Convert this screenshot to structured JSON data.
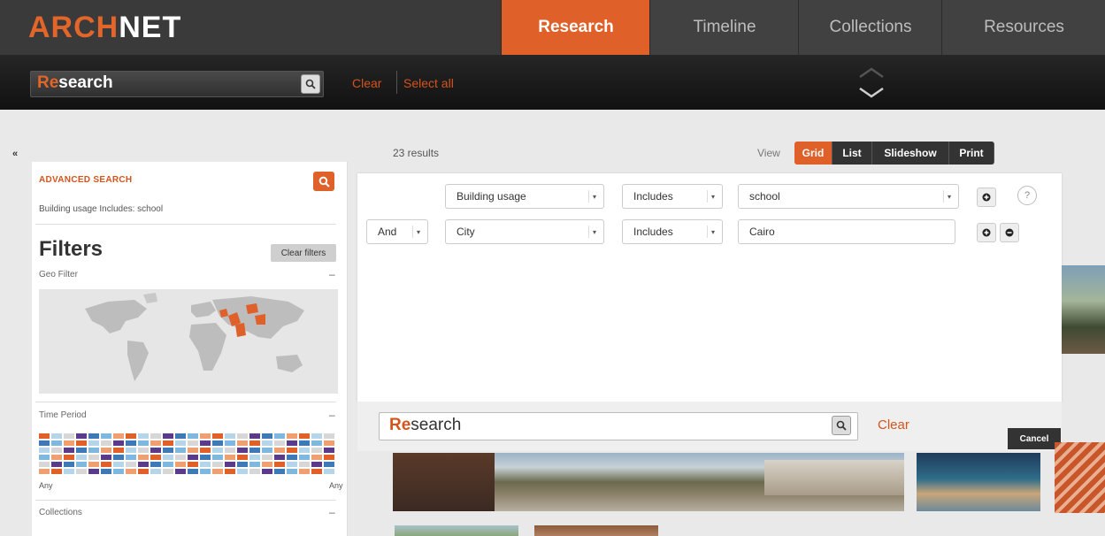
{
  "logo": {
    "part1": "ARCH",
    "part2": "NET"
  },
  "nav": {
    "tabs": [
      {
        "label": "Research",
        "active": true
      },
      {
        "label": "Timeline"
      },
      {
        "label": "Collections"
      },
      {
        "label": "Resources"
      }
    ]
  },
  "subbar": {
    "search_highlight": "Re",
    "search_rest": "search",
    "clear_label": "Clear",
    "select_all_label": "Select all"
  },
  "sidebar": {
    "collapse_glyph": "«",
    "advanced_search_title": "ADVANCED SEARCH",
    "advanced_summary": "Building usage Includes: school",
    "filters_title": "Filters",
    "clear_filters_label": "Clear filters",
    "geo_filter_label": "Geo Filter",
    "time_period_label": "Time Period",
    "time_any_left": "Any",
    "time_any_right": "Any",
    "collections_label": "Collections",
    "toggle_glyph": "–"
  },
  "results": {
    "count": "23 results",
    "view_label": "View",
    "view_options": [
      "Grid",
      "List",
      "Slideshow",
      "Print"
    ],
    "active_view": "Grid"
  },
  "advanced": {
    "rows": [
      {
        "connector": "",
        "field": "Building usage",
        "operator": "Includes",
        "value": "school"
      },
      {
        "connector": "And",
        "field": "City",
        "operator": "Includes",
        "value": "Cairo"
      }
    ],
    "help_glyph": "?"
  },
  "bottom_search": {
    "highlight": "Re",
    "rest": "search",
    "clear_label": "Clear",
    "cancel_label": "Cancel"
  },
  "colors": {
    "accent": "#e0602a",
    "nav_bg": "#3a3a3a",
    "subbar_bg": "#1a1a1a"
  }
}
